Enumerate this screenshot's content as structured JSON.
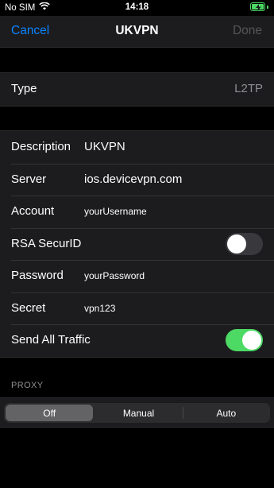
{
  "status_bar": {
    "carrier": "No SIM",
    "time": "14:18"
  },
  "nav": {
    "cancel_label": "Cancel",
    "title": "UKVPN",
    "done_label": "Done"
  },
  "type_group": {
    "label": "Type",
    "value": "L2TP"
  },
  "fields": {
    "description": {
      "label": "Description",
      "value": "UKVPN"
    },
    "server": {
      "label": "Server",
      "value": "ios.devicevpn.com"
    },
    "account": {
      "label": "Account",
      "value": "yourUsername"
    },
    "rsa": {
      "label": "RSA SecurID",
      "on": false
    },
    "password": {
      "label": "Password",
      "value": "yourPassword"
    },
    "secret": {
      "label": "Secret",
      "value": "vpn123"
    },
    "send_all": {
      "label": "Send All Traffic",
      "on": true
    }
  },
  "proxy": {
    "header": "PROXY",
    "options": [
      "Off",
      "Manual",
      "Auto"
    ],
    "selected": "Off"
  },
  "colors": {
    "accent": "#0a84ff",
    "toggle_on": "#4cd964",
    "background": "#000000",
    "cell": "#1c1c1e"
  }
}
